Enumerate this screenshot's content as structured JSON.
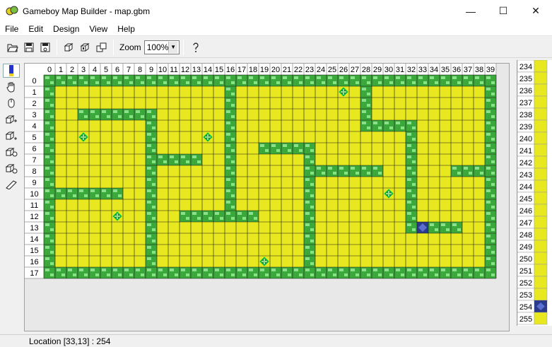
{
  "window": {
    "title": "Gameboy Map Builder - map.gbm",
    "minimize_glyph": "—",
    "maximize_glyph": "☐",
    "close_glyph": "✕"
  },
  "menu": [
    "File",
    "Edit",
    "Design",
    "View",
    "Help"
  ],
  "toolbar": {
    "buttons": [
      "open-icon",
      "save-icon",
      "save-as-icon",
      "tile-copy-icon",
      "tile-paste-icon",
      "tile-flip-icon"
    ],
    "zoom_label": "Zoom",
    "zoom_value": "100%",
    "help_icon": "help-icon"
  },
  "tools": [
    "pencil-icon",
    "hand-icon",
    "mouse-icon",
    "add-row-icon",
    "add-column-icon",
    "delete-row-icon",
    "delete-column-icon",
    "property-icon"
  ],
  "map": {
    "columns": [
      0,
      1,
      2,
      3,
      4,
      5,
      6,
      7,
      8,
      9,
      10,
      11,
      12,
      13,
      14,
      15,
      16,
      17,
      18,
      19,
      20,
      21,
      22,
      23,
      24,
      25,
      26,
      27,
      28,
      29,
      30,
      31,
      32,
      33,
      34,
      35,
      36,
      37,
      38,
      39
    ],
    "rows": [
      0,
      1,
      2,
      3,
      4,
      5,
      6,
      7,
      8,
      9,
      10,
      11,
      12,
      13,
      14,
      15,
      16,
      17
    ],
    "colors": {
      "floor": "#e8e820",
      "wall": "#3aa83a",
      "wall_highlight": "#8be08b",
      "grid": "#1a1a1a",
      "item": "#2e7d4a",
      "selected_item": "#2b3a8a"
    },
    "walls": [
      [
        0,
        0,
        0,
        39
      ],
      [
        17,
        0,
        17,
        39
      ],
      [
        0,
        0,
        17,
        0
      ],
      [
        0,
        39,
        17,
        39
      ],
      [
        3,
        3,
        3,
        9
      ],
      [
        4,
        9,
        16,
        9
      ],
      [
        7,
        10,
        7,
        13
      ],
      [
        1,
        16,
        12,
        16
      ],
      [
        12,
        12,
        12,
        18
      ],
      [
        10,
        1,
        10,
        6
      ],
      [
        6,
        19,
        6,
        23
      ],
      [
        6,
        23,
        16,
        23
      ],
      [
        8,
        24,
        8,
        29
      ],
      [
        1,
        28,
        4,
        28
      ],
      [
        4,
        28,
        4,
        32
      ],
      [
        4,
        32,
        13,
        32
      ],
      [
        13,
        32,
        13,
        36
      ],
      [
        8,
        36,
        8,
        39
      ]
    ],
    "items": [
      [
        1,
        26
      ],
      [
        5,
        3
      ],
      [
        5,
        14
      ],
      [
        10,
        30
      ],
      [
        12,
        6
      ],
      [
        16,
        19
      ]
    ],
    "selected_cell": [
      13,
      33
    ]
  },
  "palette": {
    "rows": [
      234,
      235,
      236,
      237,
      238,
      239,
      240,
      241,
      242,
      243,
      244,
      245,
      246,
      247,
      248,
      249,
      250,
      251,
      252,
      253,
      254,
      255
    ],
    "selected": 254
  },
  "status": {
    "text": "Location   [33,13] : 254"
  }
}
